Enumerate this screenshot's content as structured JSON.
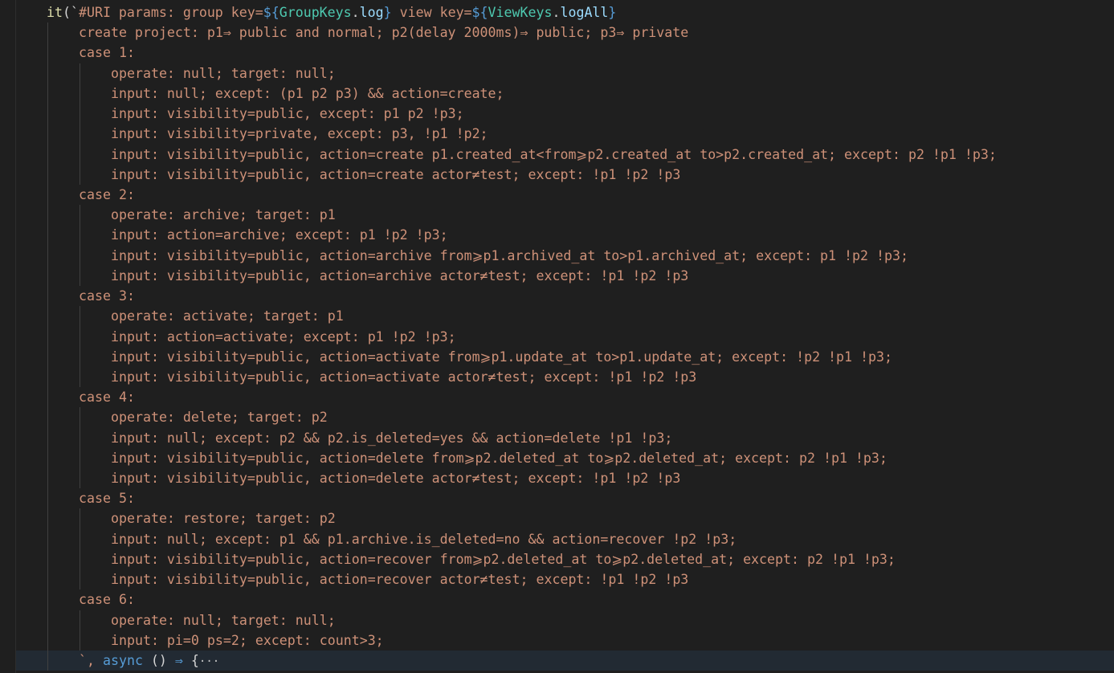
{
  "editor": {
    "header": {
      "call": "it",
      "open": "(`",
      "text_a": "#URI params: group key=",
      "tmpl1_open": "${",
      "tmpl1_obj": "GroupKeys",
      "tmpl1_dot": ".",
      "tmpl1_prop": "log",
      "tmpl1_close": "}",
      "text_b": " view key=",
      "tmpl2_open": "${",
      "tmpl2_obj": "ViewKeys",
      "tmpl2_dot": ".",
      "tmpl2_prop": "logAll",
      "tmpl2_close": "}"
    },
    "lines": [
      {
        "text": "create project: p1⇒ public and normal; p2(delay 2000ms)⇒ public; p3⇒ private"
      },
      {
        "text": "case 1:"
      },
      {
        "text": "operate: null; target: null;"
      },
      {
        "text": "input: null; except: (p1 p2 p3) && action=create;"
      },
      {
        "text": "input: visibility=public, except: p1 p2 !p3;"
      },
      {
        "text": "input: visibility=private, except: p3, !p1 !p2;"
      },
      {
        "text": "input: visibility=public, action=create p1.created_at<from⩾p2.created_at to>p2.created_at; except: p2 !p1 !p3;"
      },
      {
        "text": "input: visibility=public, action=create actor≠test; except: !p1 !p2 !p3"
      },
      {
        "text": "case 2:"
      },
      {
        "text": "operate: archive; target: p1"
      },
      {
        "text": "input: action=archive; except: p1 !p2 !p3;"
      },
      {
        "text": "input: visibility=public, action=archive from⩾p1.archived_at to>p1.archived_at; except: p1 !p2 !p3;"
      },
      {
        "text": "input: visibility=public, action=archive actor≠test; except: !p1 !p2 !p3"
      },
      {
        "text": "case 3:"
      },
      {
        "text": "operate: activate; target: p1"
      },
      {
        "text": "input: action=activate; except: p1 !p2 !p3;"
      },
      {
        "text": "input: visibility=public, action=activate from⩾p1.update_at to>p1.update_at; except: !p2 !p1 !p3;"
      },
      {
        "text": "input: visibility=public, action=activate actor≠test; except: !p1 !p2 !p3"
      },
      {
        "text": "case 4:"
      },
      {
        "text": "operate: delete; target: p2"
      },
      {
        "text": "input: null; except: p2 && p2.is_deleted=yes && action=delete !p1 !p3;"
      },
      {
        "text": "input: visibility=public, action=delete from⩾p2.deleted_at to⩾p2.deleted_at; except: p2 !p1 !p3;"
      },
      {
        "text": "input: visibility=public, action=delete actor≠test; except: !p1 !p2 !p3"
      },
      {
        "text": "case 5:"
      },
      {
        "text": "operate: restore; target: p2"
      },
      {
        "text": "input: null; except: p1 && p1.archive.is_deleted=no && action=recover !p2 !p3;"
      },
      {
        "text": "input: visibility=public, action=recover from⩾p2.deleted_at to⩾p2.deleted_at; except: p2 !p1 !p3;"
      },
      {
        "text": "input: visibility=public, action=recover actor≠test; except: !p1 !p2 !p3"
      },
      {
        "text": "case 6:"
      },
      {
        "text": "operate: null; target: null;"
      },
      {
        "text": "input: pi=0 ps=2; except: count>3;"
      }
    ],
    "footer": {
      "tick_comma": "`, ",
      "async_kw": "async",
      "parens": " () ",
      "arrow": "⇒",
      "brace": " {",
      "fold": "···"
    }
  }
}
